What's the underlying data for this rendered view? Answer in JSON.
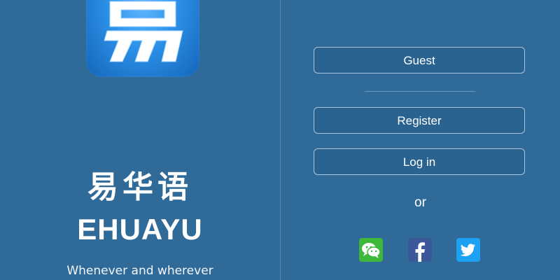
{
  "branding": {
    "app_name_cn": "易华语",
    "app_name_en": "EHUAYU",
    "tagline": "Whenever and wherever",
    "logo_glyph": "易"
  },
  "actions": {
    "guest_label": "Guest",
    "register_label": "Register",
    "login_label": "Log in",
    "or_label": "or"
  },
  "social": [
    {
      "name": "wechat-icon",
      "color": "#3eb83a"
    },
    {
      "name": "facebook-icon",
      "color": "#3b5998"
    },
    {
      "name": "twitter-icon",
      "color": "#1da1f2"
    }
  ],
  "colors": {
    "background": "#2f6a98",
    "button_fill": "#2a6390",
    "logo_blue": "#2a8fe6"
  }
}
